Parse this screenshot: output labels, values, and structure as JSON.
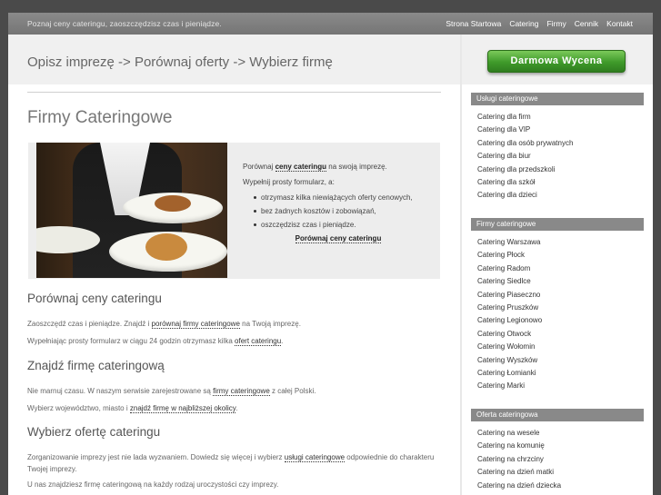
{
  "topbar": {
    "tagline": "Poznaj ceny cateringu, zaoszczędzisz czas i pieniądze.",
    "nav": [
      "Strona Startowa",
      "Catering",
      "Firmy",
      "Cennik",
      "Kontakt"
    ]
  },
  "header": {
    "slogan": "Opisz imprezę -> Porównaj oferty -> Wybierz firmę",
    "cta": "Darmowa Wycena"
  },
  "main": {
    "title": "Firmy Cateringowe",
    "promo": {
      "line1_pre": "Porównaj",
      "line1_link": "ceny cateringu",
      "line1_post": "na swoją imprezę.",
      "line2": "Wypełnij prosty formularz, a:",
      "bullets": [
        "otrzymasz kilka niewiążących oferty cenowych,",
        "bez żadnych kosztów i zobowiązań,",
        "oszczędzisz czas i pieniądze."
      ],
      "cta": "Porównaj ceny cateringu"
    },
    "sections": [
      {
        "heading": "Porównaj ceny cateringu",
        "p1_pre": "Zaoszczędź czas i pieniądze. Znajdź i",
        "p1_link": "porównaj firmy cateringowe",
        "p1_post": "na Twoją imprezę.",
        "p2_pre": "Wypełniając prosty formularz w ciągu 24 godzin otrzymasz kilka",
        "p2_link": "ofert cateringu",
        "p2_post": "."
      },
      {
        "heading": "Znajdź firmę cateringową",
        "p1_pre": "Nie marnuj czasu. W naszym serwisie zarejestrowane są",
        "p1_link": "firmy cateringowe",
        "p1_post": "z całej Polski.",
        "p2_pre": "Wybierz województwo, miasto i",
        "p2_link": "znajdź firmę w najbliższej okolicy",
        "p2_post": "."
      },
      {
        "heading": "Wybierz ofertę cateringu",
        "p1_pre": "Zorganizowanie imprezy jest nie lada wyzwaniem. Dowiedz się więcej i wybierz",
        "p1_link": "usługi cateringowe",
        "p1_post": "odpowiednie do charakteru Twojej imprezy.",
        "p2": "U nas znajdziesz firmę cateringową na każdy rodzaj uroczystości czy imprezy."
      }
    ]
  },
  "sidebar": {
    "groups": [
      {
        "title": "Usługi cateringowe",
        "items": [
          "Catering dla firm",
          "Catering dla VIP",
          "Catering dla osób prywatnych",
          "Catering dla biur",
          "Catering dla przedszkoli",
          "Catering dla szkół",
          "Catering dla dzieci"
        ]
      },
      {
        "title": "Firmy cateringowe",
        "items": [
          "Catering Warszawa",
          "Catering Płock",
          "Catering Radom",
          "Catering Siedlce",
          "Catering Piaseczno",
          "Catering Pruszków",
          "Catering Legionowo",
          "Catering Otwock",
          "Catering Wołomin",
          "Catering Wyszków",
          "Catering Łomianki",
          "Catering Marki"
        ]
      },
      {
        "title": "Oferta cateringowa",
        "items": [
          "Catering na wesele",
          "Catering na komunię",
          "Catering na chrzciny",
          "Catering na dzień matki",
          "Catering na dzień dziecka"
        ]
      }
    ]
  }
}
